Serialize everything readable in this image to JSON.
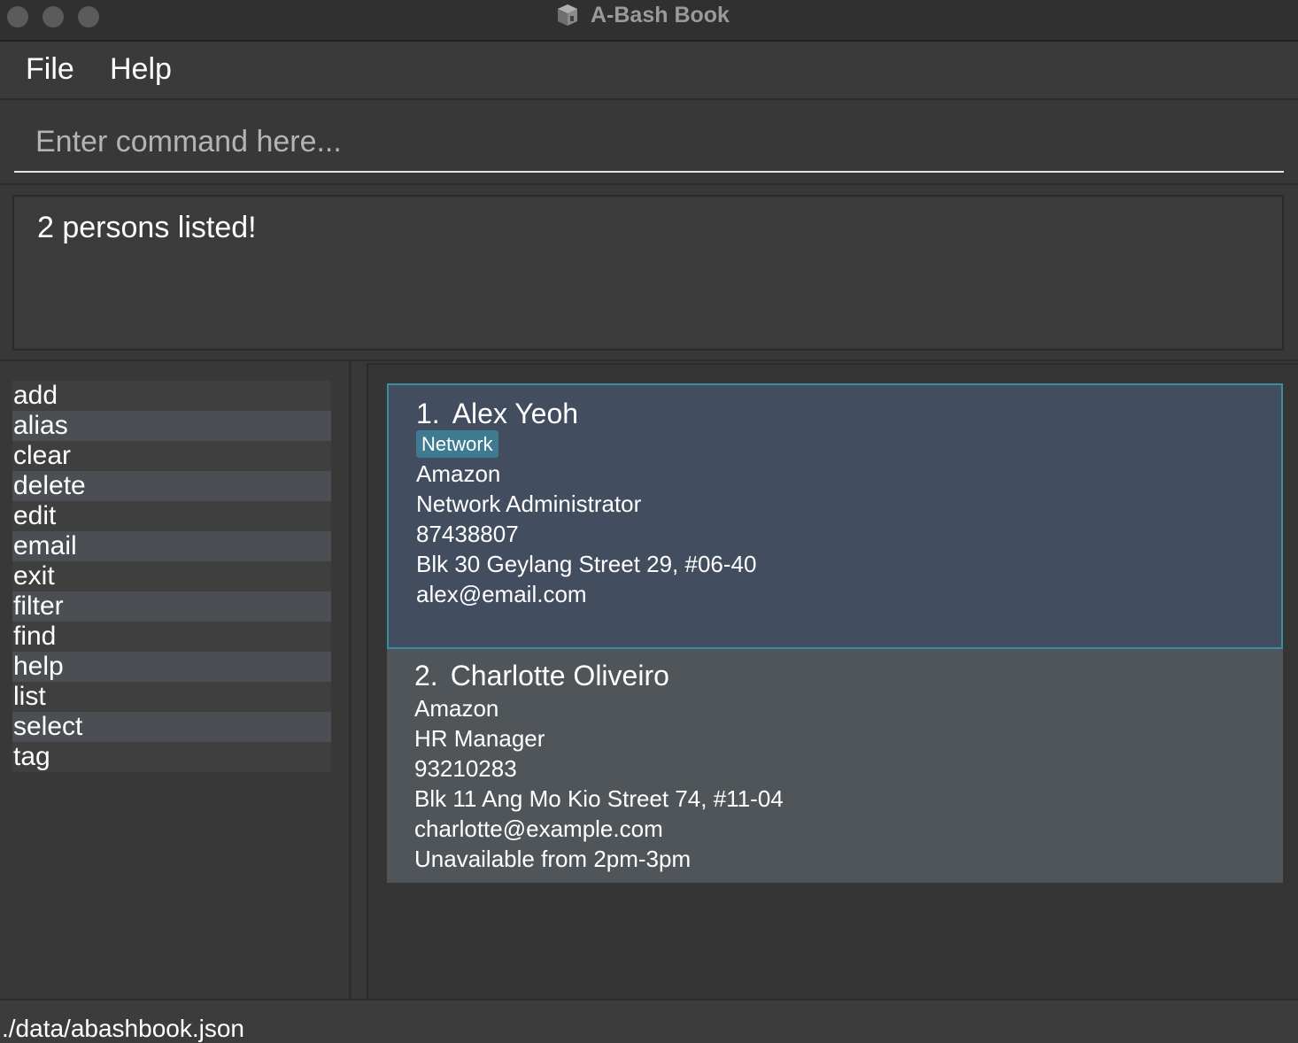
{
  "window": {
    "title": "A-Bash Book"
  },
  "menu": {
    "file_label": "File",
    "help_label": "Help"
  },
  "command_box": {
    "placeholder": "Enter command here...",
    "value": ""
  },
  "result_display": {
    "text": "2 persons listed!"
  },
  "command_list": [
    "add",
    "alias",
    "clear",
    "delete",
    "edit",
    "email",
    "exit",
    "filter",
    "find",
    "help",
    "list",
    "select",
    "tag"
  ],
  "persons": [
    {
      "index": "1.",
      "name": "Alex Yeoh",
      "tags": [
        "Network"
      ],
      "company": "Amazon",
      "job_title": "Network Administrator",
      "phone": "87438807",
      "address": "Blk 30 Geylang Street 29, #06-40",
      "email": "alex@email.com",
      "selected": true
    },
    {
      "index": "2.",
      "name": "Charlotte Oliveiro",
      "tags": [],
      "company": "Amazon",
      "job_title": "HR Manager",
      "phone": "93210283",
      "address": "Blk 11 Ang Mo Kio Street 74, #11-04",
      "email": "charlotte@example.com",
      "remark": "Unavailable from 2pm-3pm",
      "selected": false
    }
  ],
  "status_bar": {
    "file_path": "./data/abashbook.json"
  },
  "colors": {
    "background": "#383838",
    "selected_card": "#424d5f",
    "selected_border": "#3a8ea0",
    "card": "#50555a",
    "tag": "#3e7b91"
  },
  "icons": {
    "app": "book-cube-icon"
  }
}
